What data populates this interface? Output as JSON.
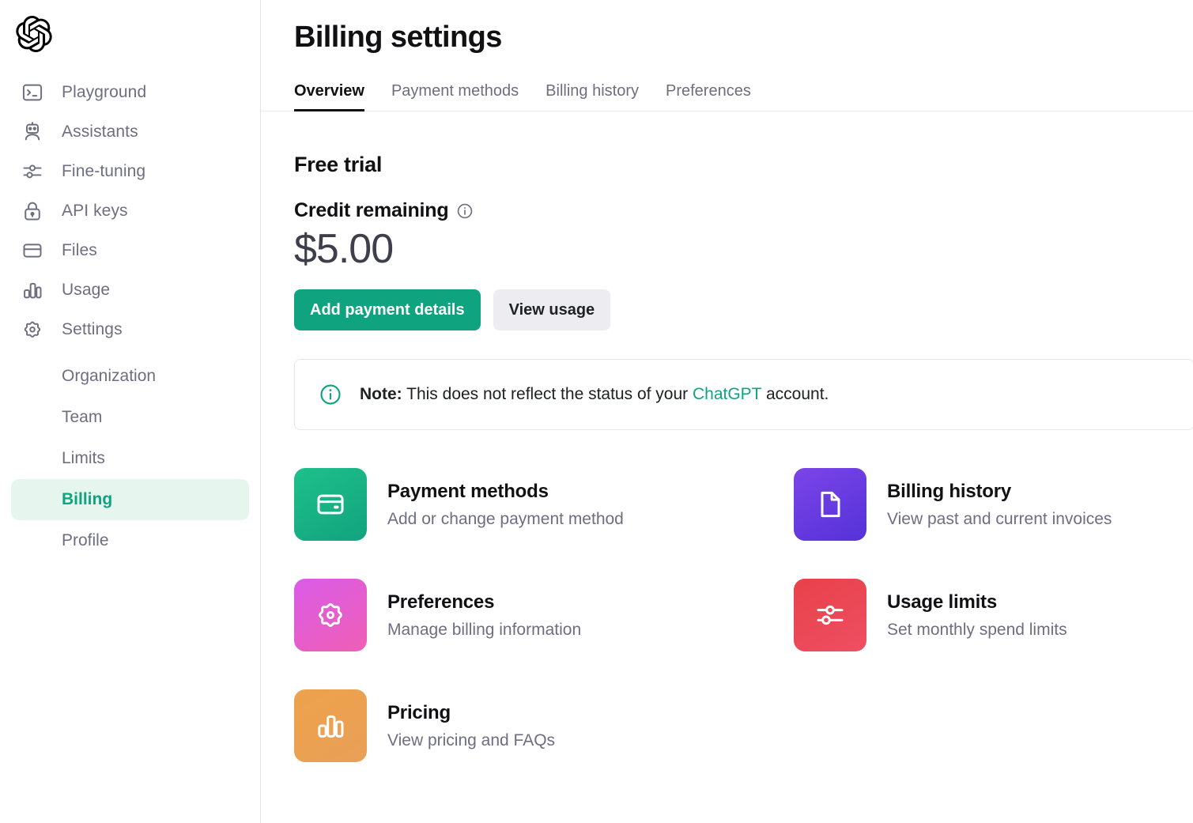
{
  "brand": {
    "logo_name": "openai-logo"
  },
  "sidebar": {
    "items": [
      {
        "label": "Playground",
        "icon": "terminal-icon"
      },
      {
        "label": "Assistants",
        "icon": "robot-icon"
      },
      {
        "label": "Fine-tuning",
        "icon": "sliders-icon"
      },
      {
        "label": "API keys",
        "icon": "lock-icon"
      },
      {
        "label": "Files",
        "icon": "folder-icon"
      },
      {
        "label": "Usage",
        "icon": "bar-chart-icon"
      },
      {
        "label": "Settings",
        "icon": "gear-icon"
      }
    ],
    "subitems": [
      {
        "label": "Organization",
        "active": false
      },
      {
        "label": "Team",
        "active": false
      },
      {
        "label": "Limits",
        "active": false
      },
      {
        "label": "Billing",
        "active": true
      },
      {
        "label": "Profile",
        "active": false
      }
    ],
    "active_color": "#10a37f",
    "active_background": "#e7f5ef"
  },
  "header": {
    "title": "Billing settings",
    "tabs": [
      {
        "label": "Overview",
        "active": true
      },
      {
        "label": "Payment methods",
        "active": false
      },
      {
        "label": "Billing history",
        "active": false
      },
      {
        "label": "Preferences",
        "active": false
      }
    ]
  },
  "overview": {
    "plan_title": "Free trial",
    "credit_label": "Credit remaining",
    "credit_info_icon": "info-circle-icon",
    "credit_amount": "$5.00",
    "primary_button": "Add payment details",
    "secondary_button": "View usage",
    "primary_button_color": "#10a37f",
    "secondary_button_color": "#ececf1"
  },
  "note": {
    "icon": "info-circle-icon",
    "label": "Note:",
    "text_before": " This does not reflect the status of your ",
    "link_text": "ChatGPT",
    "text_after": " account.",
    "link_color": "#10a37f"
  },
  "cards": [
    {
      "title": "Payment methods",
      "subtitle": "Add or change payment method",
      "icon": "credit-card-icon",
      "color": "#16b085"
    },
    {
      "title": "Billing history",
      "subtitle": "View past and current invoices",
      "icon": "document-icon",
      "color": "#6239e0"
    },
    {
      "title": "Preferences",
      "subtitle": "Manage billing information",
      "icon": "gear-flower-icon",
      "color": "#df5dd2"
    },
    {
      "title": "Usage limits",
      "subtitle": "Set monthly spend limits",
      "icon": "sliders-icon",
      "color": "#eb4856"
    },
    {
      "title": "Pricing",
      "subtitle": "View pricing and FAQs",
      "icon": "bar-chart-icon",
      "color": "#eca153"
    }
  ]
}
